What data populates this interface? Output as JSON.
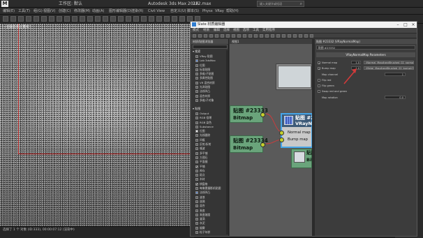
{
  "max": {
    "title_left": "工作区: 默认",
    "app_title": "Autodesk 3ds Max 2016",
    "file_name": "222.max",
    "search_placeholder": "键入关键字或短语",
    "menu": [
      "编辑(E)",
      "工具(T)",
      "组(G)",
      "视图(V)",
      "创建(C)",
      "修改器(M)",
      "动画(A)",
      "图形编辑器(D)",
      "渲染(R)",
      "Civil View",
      "自定义(U)",
      "脚本(S)",
      "Physx",
      "VRay",
      "帮助(H)"
    ],
    "viewport_label": "[+][摄影机][真实]",
    "status_text": "选择了 1 个 对象 (ID:333), 00:00:07:12 (渲染中)"
  },
  "slate": {
    "title": "Slate 材质编辑器",
    "menu": [
      "模式",
      "材质",
      "编辑",
      "选择",
      "视图",
      "选项",
      "工具",
      "实用程序"
    ],
    "browser": {
      "header": "材质/贴图浏览器",
      "group_search": "▾ 搜索",
      "group_maps": "▾ 贴图",
      "items": [
        {
          "label": "Output",
          "sw": "gray"
        },
        {
          "label": "RGB 倍增",
          "sw": "gray"
        },
        {
          "label": "RGB 染色",
          "sw": "gray"
        },
        {
          "label": "Substance",
          "sw": "gray"
        },
        {
          "label": "位图",
          "sw": "white"
        },
        {
          "label": "光线跟踪",
          "sw": "gray"
        },
        {
          "label": "凹痕",
          "sw": "gray"
        },
        {
          "label": "反射/折射",
          "sw": "gray"
        },
        {
          "label": "噪波",
          "sw": "gray"
        },
        {
          "label": "多平铺",
          "sw": "gray"
        },
        {
          "label": "大理石",
          "sw": "gray"
        },
        {
          "label": "平面镜",
          "sw": "gray"
        },
        {
          "label": "平铺",
          "sw": "check"
        },
        {
          "label": "库存",
          "sw": "gray"
        },
        {
          "label": "斑点",
          "sw": "gray"
        },
        {
          "label": "木材",
          "sw": "gray"
        },
        {
          "label": "棋盘格",
          "sw": "check"
        },
        {
          "label": "每像素摄影机贴图",
          "sw": "gray"
        },
        {
          "label": "法线凹凸",
          "sw": "blue"
        },
        {
          "label": "波浪",
          "sw": "gray"
        },
        {
          "label": "泼溅",
          "sw": "gray"
        },
        {
          "label": "混合",
          "sw": "gray"
        },
        {
          "label": "渐变",
          "sw": "gray"
        },
        {
          "label": "渐变坡度",
          "sw": "gray"
        },
        {
          "label": "漩涡",
          "sw": "gray"
        },
        {
          "label": "灰泥",
          "sw": "gray"
        },
        {
          "label": "烟雾",
          "sw": "gray"
        },
        {
          "label": "粒子年龄",
          "sw": "gray"
        }
      ],
      "top_list": [
        {
          "label": "VRay 贴图",
          "sw": "gray"
        },
        {
          "label": "Lab 3dsMax",
          "sw": "blue"
        },
        {
          "label": "位图",
          "sw": "gray"
        },
        {
          "label": "标准贴图",
          "sw": "gray"
        },
        {
          "label": "多维/子贴图",
          "sw": "gray"
        },
        {
          "label": "多属性贴图",
          "sw": "gray"
        },
        {
          "label": "VR 混合材质",
          "sw": "gray"
        },
        {
          "label": "光泽贴图",
          "sw": "gray"
        },
        {
          "label": "法线凹凸",
          "sw": "gray"
        },
        {
          "label": "混合材质",
          "sw": "gray"
        },
        {
          "label": "多维/子对象",
          "sw": "gray"
        }
      ]
    },
    "view_tab": "视图1",
    "nodes": {
      "bitmap1_title": "贴图 #23333",
      "bitmap1_type": "Bitmap",
      "bitmap2_title": "贴图 #23334",
      "bitmap2_type": "Bitmap",
      "vray_title": "贴图 #2",
      "vray_type": "VRayNormalMap",
      "vray_inputs": [
        "Normal map",
        "Bump map"
      ],
      "bitmap3_title": "贴图",
      "bitmap3_type": "Bitm"
    },
    "params": {
      "header": "贴图 #23332 (VRayNormalMap)",
      "name_field": "贴图 #23332",
      "rollout": "VRayNormalMap Parameters",
      "rows": [
        {
          "label": "Normal map",
          "value": "1.0",
          "map": "(Normal_Map#andBrushed_02_normal)(0)",
          "checked": true
        },
        {
          "label": "Bump map",
          "value": "1.0",
          "map": "(Metal_Map#andBrushed_02_bump)(0)",
          "checked": true
        },
        {
          "label": "Map channel",
          "spin": "1"
        },
        {
          "label": "Flip red",
          "checked": false
        },
        {
          "label": "Flip green",
          "checked": false
        },
        {
          "label": "Swap red and green",
          "checked": false
        },
        {
          "label": "Map rotation",
          "spin": "0.0"
        }
      ]
    }
  },
  "colors": {
    "accent_arrow": "#d23a3a",
    "node_green": "#6aa47b",
    "socket": "#c4d02c",
    "select_blue": "#46a6e8"
  }
}
